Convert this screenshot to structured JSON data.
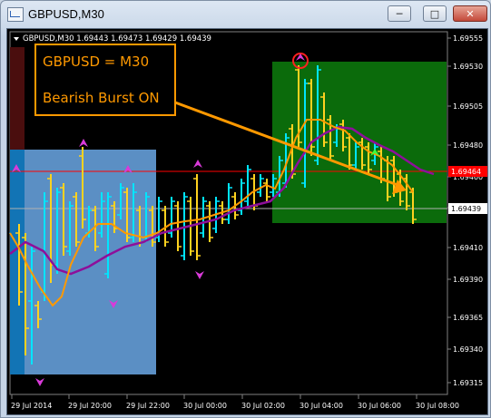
{
  "window": {
    "title": "GBPUSD,M30",
    "icon": "chart-window-icon",
    "buttons": {
      "minimize": "minimize-icon",
      "maximize": "maximize-icon",
      "close": "close-icon"
    }
  },
  "chart": {
    "header_text": "GBPUSD,M30  1.69443 1.69473 1.69429 1.69439",
    "annotation_lines": [
      "GBPUSD = M30",
      "Bearish Burst ON"
    ],
    "price_labels": [
      "1.69555",
      "1.69530",
      "1.69505",
      "1.69480",
      "1.69460",
      "1.69435",
      "1.69410",
      "1.69390",
      "1.69365",
      "1.69340",
      "1.69315"
    ],
    "current_price_label": "1.69464",
    "bid_price_label": "1.69439",
    "time_labels": [
      "29 Jul 2014",
      "29 Jul 20:00",
      "29 Jul 22:00",
      "30 Jul 00:00",
      "30 Jul 02:00",
      "30 Jul 04:00",
      "30 Jul 06:00",
      "30 Jul 08:00"
    ],
    "colors": {
      "background": "#000000",
      "bull_bar": "#00e5ff",
      "bear_bar": "#ffd21f",
      "box_left": "#5b8fc4",
      "box_right": "#0b6b0b",
      "ma_fast": "#ff9900",
      "ma_slow": "#8e0f9a",
      "arrow_marker": "#d93ad9",
      "current_price_line": "#ff0000",
      "annotation": "#ff9900"
    }
  }
}
